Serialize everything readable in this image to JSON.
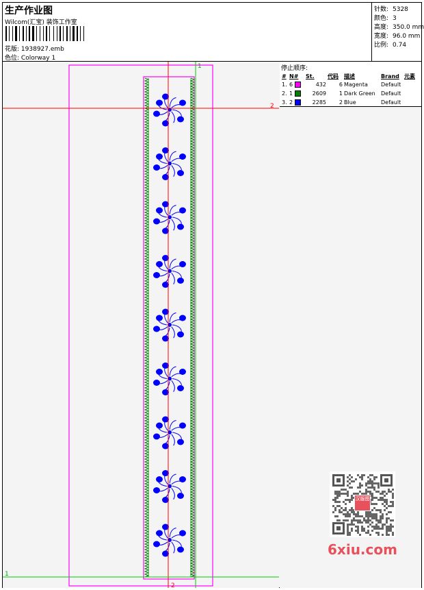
{
  "header": {
    "title": "生产作业图",
    "company": "Wilcom(汇宝) 装饰工作室",
    "design_label": "花版:",
    "design_value": "1938927.emb",
    "colorway_label": "色位:",
    "colorway_value": "Colorway 1"
  },
  "stats": [
    {
      "label": "针数:",
      "value": "5328"
    },
    {
      "label": "颜色:",
      "value": "3"
    },
    {
      "label": "高度:",
      "value": "350.0 mm"
    },
    {
      "label": "宽度:",
      "value": "96.0 mm"
    },
    {
      "label": "比例:",
      "value": "0.74"
    }
  ],
  "stop_sequence": {
    "title": "停止顺序:",
    "headers": [
      "#",
      "N#",
      "St.",
      "代码",
      "描述",
      "Brand",
      "元素"
    ],
    "rows": [
      {
        "num": "1.",
        "needle": "6",
        "color": "#ff00ff",
        "stitches": "432",
        "code": "6",
        "desc": "Magenta",
        "brand": "Default"
      },
      {
        "num": "2.",
        "needle": "1",
        "color": "#008000",
        "stitches": "2609",
        "code": "1",
        "desc": "Dark Green",
        "brand": "Default"
      },
      {
        "num": "3.",
        "needle": "2",
        "color": "#0000ff",
        "stitches": "2285",
        "code": "2",
        "desc": "Blue",
        "brand": "Default"
      }
    ]
  },
  "markers": {
    "red_h": "2",
    "red_v": "2",
    "green_h": "1",
    "green_v": "1"
  },
  "motif_count": 9,
  "watermark": {
    "site": "6xiu.com",
    "seal_text": "汉服图"
  }
}
